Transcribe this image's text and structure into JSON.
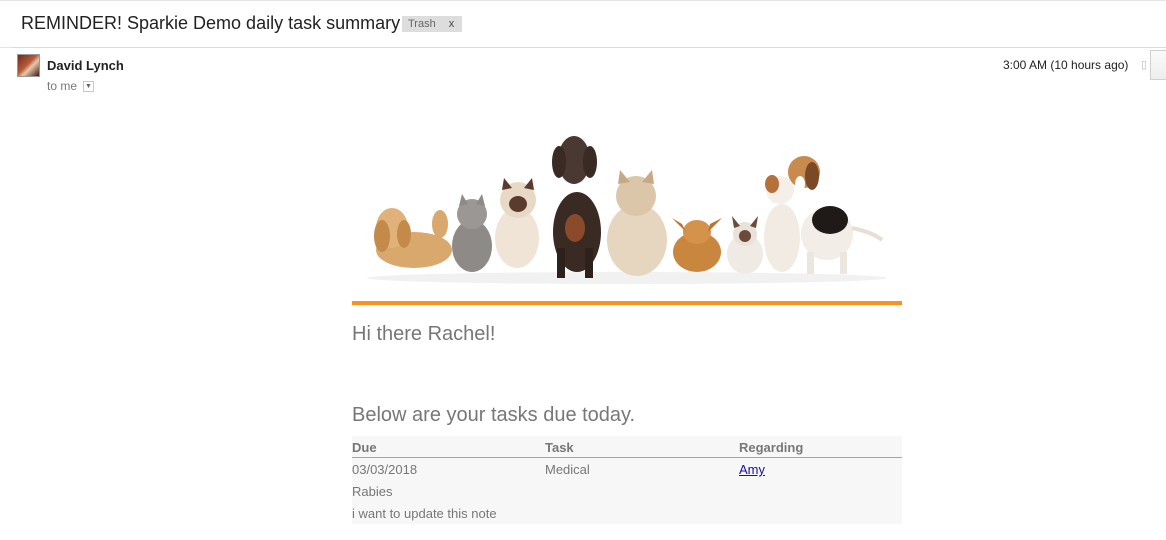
{
  "email": {
    "subject": "REMINDER! Sparkie Demo daily task summary",
    "label": {
      "name": "Trash",
      "remove": "x"
    },
    "sender": "David Lynch",
    "recipient": "to me",
    "timestamp": "3:00 AM (10 hours ago)"
  },
  "body": {
    "greeting": "Hi there Rachel!",
    "tasks_heading": "Below are your tasks due today.",
    "table": {
      "headers": [
        "Due",
        "Task",
        "Regarding"
      ],
      "rows": [
        {
          "due": "03/03/2018",
          "task": "Medical",
          "regarding": "Amy",
          "title": "Rabies",
          "note": "i want to update this note"
        }
      ]
    }
  },
  "icons": {
    "avatar": "sender-avatar",
    "caret": "chevron-down-icon",
    "star": "star-icon"
  },
  "colors": {
    "accent": "#f7931e",
    "link": "#1a0dab",
    "muted_text": "#777777"
  }
}
